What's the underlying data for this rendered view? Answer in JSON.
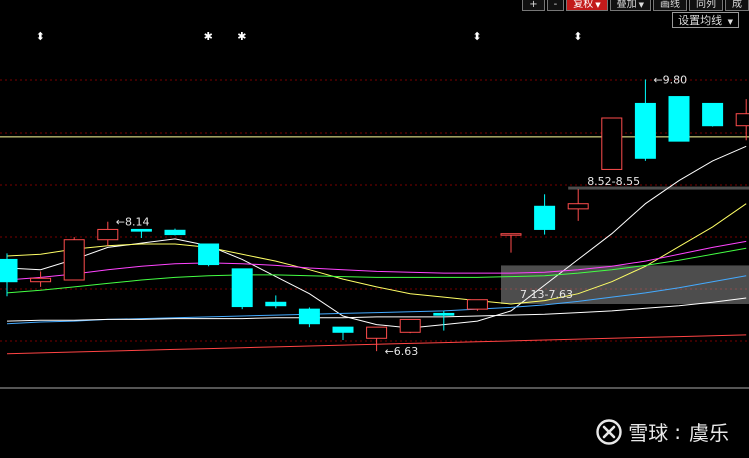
{
  "toolbar": {
    "buttons": [
      "+",
      "-",
      "复权",
      "叠加",
      "画线",
      "同列",
      "成"
    ],
    "active_index": 2,
    "dropdown_indices": [
      2,
      3
    ],
    "ma_settings": "设置均线"
  },
  "watermark": {
    "brand": "雪球",
    "author": "虞乐"
  },
  "colors": {
    "up": "#ff4d4d",
    "down": "#00ffff",
    "grid": "#7a0000",
    "ma5": "#ffffff",
    "ma10": "#ffff66",
    "ma20": "#ff44ff",
    "ma30": "#44ff44",
    "ma60": "#44aaff",
    "ma120": "#ffffff",
    "ma250": "#ff4444"
  },
  "chart_data": {
    "type": "candlestick",
    "ylim": [
      6.2,
      10.4
    ],
    "event_markers": [
      {
        "index": 1,
        "symbol": "⬍"
      },
      {
        "index": 6,
        "symbol": "✱"
      },
      {
        "index": 7,
        "symbol": "✱"
      },
      {
        "index": 14,
        "symbol": "⬍"
      },
      {
        "index": 17,
        "symbol": "⬍"
      }
    ],
    "candles": [
      {
        "o": 7.7,
        "h": 7.77,
        "l": 7.27,
        "c": 7.44
      },
      {
        "o": 7.44,
        "h": 7.56,
        "l": 7.38,
        "c": 7.48
      },
      {
        "o": 7.46,
        "h": 7.96,
        "l": 7.46,
        "c": 7.93
      },
      {
        "o": 7.93,
        "h": 8.14,
        "l": 7.86,
        "c": 8.05
      },
      {
        "o": 8.05,
        "h": 8.05,
        "l": 7.95,
        "c": 8.03
      },
      {
        "o": 8.04,
        "h": 8.06,
        "l": 7.98,
        "c": 7.99
      },
      {
        "o": 7.88,
        "h": 7.88,
        "l": 7.62,
        "c": 7.64
      },
      {
        "o": 7.59,
        "h": 7.59,
        "l": 7.12,
        "c": 7.15
      },
      {
        "o": 7.2,
        "h": 7.28,
        "l": 7.13,
        "c": 7.16
      },
      {
        "o": 7.12,
        "h": 7.14,
        "l": 6.91,
        "c": 6.95
      },
      {
        "o": 6.91,
        "h": 6.91,
        "l": 6.76,
        "c": 6.85
      },
      {
        "o": 6.78,
        "h": 6.9,
        "l": 6.63,
        "c": 6.91
      },
      {
        "o": 6.85,
        "h": 7.0,
        "l": 6.84,
        "c": 7.0
      },
      {
        "o": 7.07,
        "h": 7.1,
        "l": 6.87,
        "c": 7.05
      },
      {
        "o": 7.12,
        "h": 7.23,
        "l": 7.1,
        "c": 7.23
      },
      {
        "o": 8.0,
        "h": 8.0,
        "l": 7.78,
        "c": 8.0
      },
      {
        "o": 8.32,
        "h": 8.46,
        "l": 7.99,
        "c": 8.05
      },
      {
        "o": 8.29,
        "h": 8.52,
        "l": 8.15,
        "c": 8.35
      },
      {
        "o": 8.75,
        "h": 9.35,
        "l": 8.75,
        "c": 9.35
      },
      {
        "o": 9.52,
        "h": 9.8,
        "l": 8.85,
        "c": 8.88
      },
      {
        "o": 9.6,
        "h": 9.6,
        "l": 9.08,
        "c": 9.08
      },
      {
        "o": 9.52,
        "h": 9.52,
        "l": 9.25,
        "c": 9.26
      },
      {
        "o": 9.26,
        "h": 9.57,
        "l": 9.09,
        "c": 9.4
      }
    ],
    "annotations": [
      {
        "index": 3,
        "price": 8.14,
        "text": "8.14"
      },
      {
        "index": 11,
        "price": 6.63,
        "text": "6.63"
      },
      {
        "index": 19,
        "price": 9.8,
        "text": "9.80"
      }
    ],
    "range_labels": [
      {
        "index": 15,
        "price": 7.25,
        "text": "7.13-7.63",
        "band": [
          7.18,
          7.63
        ]
      },
      {
        "index": 17,
        "price": 8.57,
        "text": "8.52-8.55",
        "band": [
          8.52,
          8.55
        ]
      }
    ],
    "horizontal_line": 9.13,
    "ma_lines": [
      {
        "key": "ma5",
        "values": [
          7.6,
          7.58,
          7.7,
          7.84,
          7.89,
          7.94,
          7.86,
          7.7,
          7.5,
          7.3,
          7.04,
          6.94,
          6.9,
          6.94,
          6.98,
          7.1,
          7.4,
          7.7,
          8.0,
          8.35,
          8.62,
          8.85,
          9.02
        ]
      },
      {
        "key": "ma10",
        "values": [
          7.74,
          7.76,
          7.82,
          7.86,
          7.88,
          7.88,
          7.84,
          7.76,
          7.68,
          7.58,
          7.47,
          7.38,
          7.3,
          7.26,
          7.22,
          7.18,
          7.22,
          7.3,
          7.44,
          7.62,
          7.85,
          8.08,
          8.35
        ]
      },
      {
        "key": "ma20",
        "values": [
          7.46,
          7.49,
          7.53,
          7.58,
          7.62,
          7.65,
          7.66,
          7.65,
          7.63,
          7.6,
          7.58,
          7.56,
          7.55,
          7.54,
          7.54,
          7.54,
          7.55,
          7.58,
          7.62,
          7.68,
          7.76,
          7.84,
          7.91
        ]
      },
      {
        "key": "ma30",
        "values": [
          7.31,
          7.34,
          7.38,
          7.42,
          7.46,
          7.49,
          7.51,
          7.52,
          7.52,
          7.51,
          7.5,
          7.49,
          7.49,
          7.49,
          7.49,
          7.5,
          7.51,
          7.54,
          7.58,
          7.63,
          7.69,
          7.76,
          7.83
        ]
      },
      {
        "key": "ma60",
        "values": [
          6.95,
          6.97,
          6.98,
          7.0,
          7.01,
          7.02,
          7.03,
          7.04,
          7.05,
          7.06,
          7.07,
          7.08,
          7.09,
          7.1,
          7.12,
          7.14,
          7.17,
          7.21,
          7.26,
          7.31,
          7.37,
          7.44,
          7.51
        ]
      },
      {
        "key": "ma120",
        "values": [
          6.98,
          6.99,
          6.99,
          7.0,
          7.0,
          7.01,
          7.01,
          7.01,
          7.02,
          7.02,
          7.02,
          7.03,
          7.03,
          7.03,
          7.04,
          7.05,
          7.06,
          7.08,
          7.1,
          7.13,
          7.16,
          7.2,
          7.25
        ]
      },
      {
        "key": "ma250",
        "values": [
          6.6,
          6.61,
          6.62,
          6.63,
          6.64,
          6.65,
          6.66,
          6.67,
          6.68,
          6.69,
          6.7,
          6.71,
          6.72,
          6.73,
          6.74,
          6.75,
          6.76,
          6.77,
          6.78,
          6.79,
          6.8,
          6.81,
          6.82
        ]
      }
    ]
  }
}
